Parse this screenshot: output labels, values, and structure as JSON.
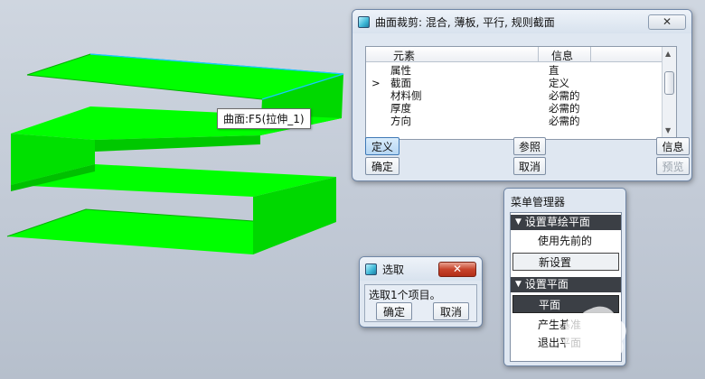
{
  "tooltip": {
    "text": "曲面:F5(拉伸_1)"
  },
  "feature_dialog": {
    "title": "曲面裁剪: 混合, 薄板, 平行, 规则截面",
    "columns": [
      "元素",
      "信息"
    ],
    "rows": [
      {
        "marker": "",
        "element": "属性",
        "info": "直"
      },
      {
        "marker": ">",
        "element": "截面",
        "info": "定义"
      },
      {
        "marker": "",
        "element": "材料侧",
        "info": "必需的"
      },
      {
        "marker": "",
        "element": "厚度",
        "info": "必需的"
      },
      {
        "marker": "",
        "element": "方向",
        "info": "必需的"
      }
    ],
    "buttons": {
      "define": "定义",
      "reference": "参照",
      "info": "信息",
      "ok": "确定",
      "cancel": "取消",
      "preview": "预览"
    }
  },
  "select_dialog": {
    "title": "选取",
    "close_label": "✕",
    "message": "选取1个项目。",
    "ok": "确定",
    "cancel": "取消"
  },
  "menu_manager": {
    "title": "菜单管理器",
    "sections": [
      {
        "header": "设置草绘平面",
        "items": [
          "使用先前的",
          "新设置"
        ]
      },
      {
        "header": "设置平面",
        "items": [
          "平面",
          "产生基准",
          "退出平面"
        ]
      }
    ]
  },
  "colors": {
    "surface_top": "#00ff00",
    "surface_side": "#00d800",
    "surface_edge": "#00a800",
    "highlight_edge": "#19c8ff",
    "menu_header_bg": "#3b3f45"
  },
  "icons": {
    "app": "app-icon",
    "close": "close-icon",
    "collapse": "triangle-down-icon",
    "scroll_up": "scroll-up-arrow-icon",
    "scroll_down": "scroll-down-arrow-icon"
  }
}
